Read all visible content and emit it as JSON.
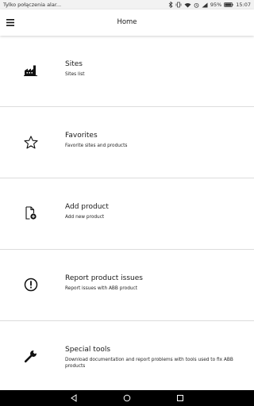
{
  "status_bar": {
    "notification_text": "Tylko połączenia alar...",
    "battery_percent": "95%",
    "time": "15:07"
  },
  "app_bar": {
    "title": "Home",
    "menu_icon": "hamburger-menu-icon"
  },
  "menu_items": [
    {
      "title": "Sites",
      "subtitle": "Sites list",
      "icon": "factory-icon"
    },
    {
      "title": "Favorites",
      "subtitle": "Favorite sites and products",
      "icon": "star-icon"
    },
    {
      "title": "Add product",
      "subtitle": "Add new product",
      "icon": "add-document-icon"
    },
    {
      "title": "Report product issues",
      "subtitle": "Report issues with ABB product",
      "icon": "exclamation-circle-icon"
    },
    {
      "title": "Special tools",
      "subtitle": "Download documentation and report problems with tools used to fix ABB products",
      "icon": "wrench-icon"
    }
  ],
  "nav_bar": {
    "back_icon": "back-triangle-icon",
    "home_icon": "home-circle-icon",
    "recents_icon": "recents-square-icon"
  },
  "colors": {
    "status_bar_bg": "#f2f2f2",
    "nav_bar_bg": "#000000",
    "divider": "#dcdcdc",
    "text": "#1a1a1a"
  }
}
